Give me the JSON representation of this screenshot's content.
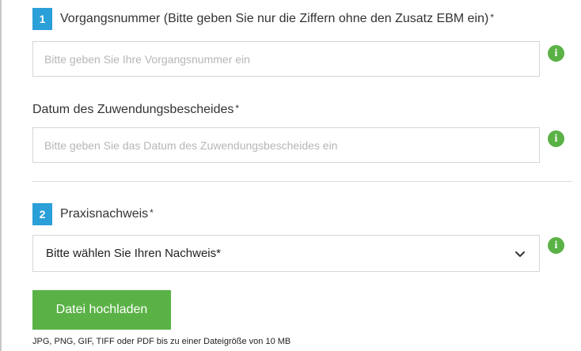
{
  "section1": {
    "number": "1",
    "label": "Vorgangsnummer (Bitte geben Sie nur die Ziffern ohne den Zusatz EBM ein)",
    "required_mark": "*",
    "input_placeholder": "Bitte geben Sie Ihre Vorgangsnummer ein",
    "input_value": ""
  },
  "date_field": {
    "label": "Datum des Zuwendungsbescheides",
    "required_mark": "*",
    "input_placeholder": "Bitte geben Sie das Datum des Zuwendungsbescheides ein",
    "input_value": ""
  },
  "section2": {
    "number": "2",
    "label": "Praxisnachweis",
    "required_mark": "*",
    "select_value": "Bitte wählen Sie Ihren Nachweis*"
  },
  "info_icon_glyph": "i",
  "upload": {
    "button_label": "Datei hochladen",
    "hint": "JPG, PNG, GIF, TIFF oder PDF bis zu einer Dateigröße von 10 MB"
  },
  "colors": {
    "step_badge": "#2a9fd8",
    "info_icon": "#5ab246",
    "upload_button": "#5ab246",
    "input_border": "#d6d6d6"
  },
  "icons": {
    "info": "info-icon",
    "select_arrow": "chevron-down-icon"
  }
}
